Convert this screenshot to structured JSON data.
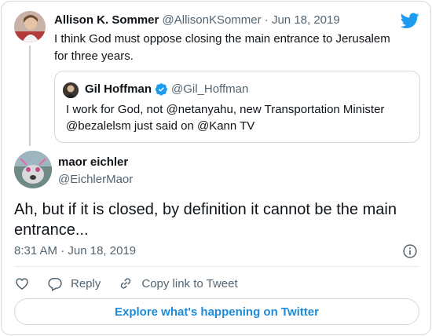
{
  "parent_tweet": {
    "name": "Allison K. Sommer",
    "handle": "@AllisonKSommer",
    "separator": "·",
    "date": "Jun 18, 2019",
    "text": "I think God must oppose closing the main entrance to Jerusalem for three years."
  },
  "quoted_tweet": {
    "name": "Gil Hoffman",
    "handle": "@Gil_Hoffman",
    "text": "I work for God, not @netanyahu, new Transportation Minister @bezalelsm just said on @Kann TV"
  },
  "main_tweet": {
    "name": "maor eichler",
    "handle": "@EichlerMaor",
    "text": "Ah, but if it is closed, by definition it cannot be the main entrance...",
    "time": "8:31 AM",
    "separator": "·",
    "date": "Jun 18, 2019"
  },
  "actions": {
    "reply_label": "Reply",
    "copy_link_label": "Copy link to Tweet"
  },
  "explore_button": "Explore what's happening on Twitter",
  "colors": {
    "twitter_blue": "#1d9bf0",
    "link_blue": "#1d8cd8",
    "muted_text": "#536471",
    "border": "#cfd9de"
  },
  "icons": [
    "twitter-bird-icon",
    "verified-badge-icon",
    "info-icon",
    "heart-icon",
    "reply-icon",
    "link-icon"
  ]
}
